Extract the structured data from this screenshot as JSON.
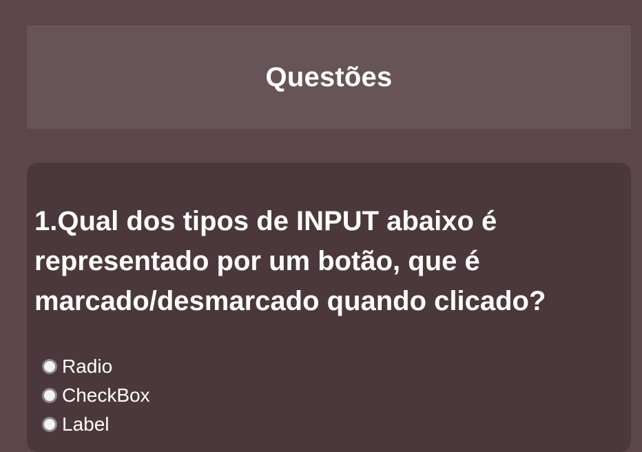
{
  "header": {
    "title": "Questões"
  },
  "question": {
    "text": "1.Qual dos tipos de INPUT abaixo é representado por um botão, que é marcado/desmarcado quando clicado?",
    "options": [
      {
        "label": "Radio",
        "checked": false
      },
      {
        "label": "CheckBox",
        "checked": false
      },
      {
        "label": "Label",
        "checked": false
      }
    ]
  },
  "colors": {
    "page_background": "#5a464b",
    "header_background": "#675459",
    "card_background": "#4b383d",
    "text": "#ffffff"
  }
}
